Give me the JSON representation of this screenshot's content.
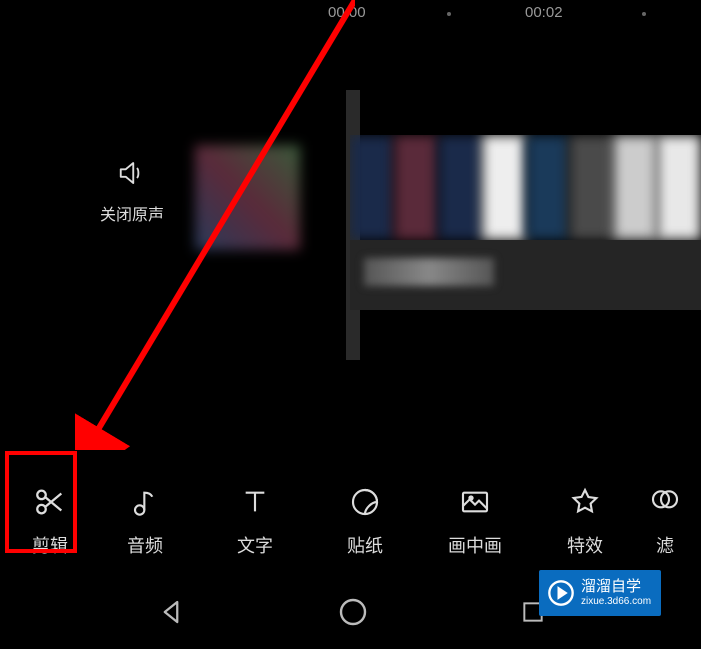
{
  "timeline": {
    "time_markers": [
      "00:00",
      "00:02"
    ]
  },
  "mute": {
    "label": "关闭原声"
  },
  "toolbar": {
    "items": [
      {
        "label": "剪辑",
        "icon": "scissors"
      },
      {
        "label": "音频",
        "icon": "note"
      },
      {
        "label": "文字",
        "icon": "text"
      },
      {
        "label": "贴纸",
        "icon": "sticker"
      },
      {
        "label": "画中画",
        "icon": "pip"
      },
      {
        "label": "特效",
        "icon": "star"
      },
      {
        "label": "滤",
        "icon": "filter"
      }
    ]
  },
  "watermark": {
    "title": "溜溜自学",
    "sub": "zixue.3d66.com"
  }
}
